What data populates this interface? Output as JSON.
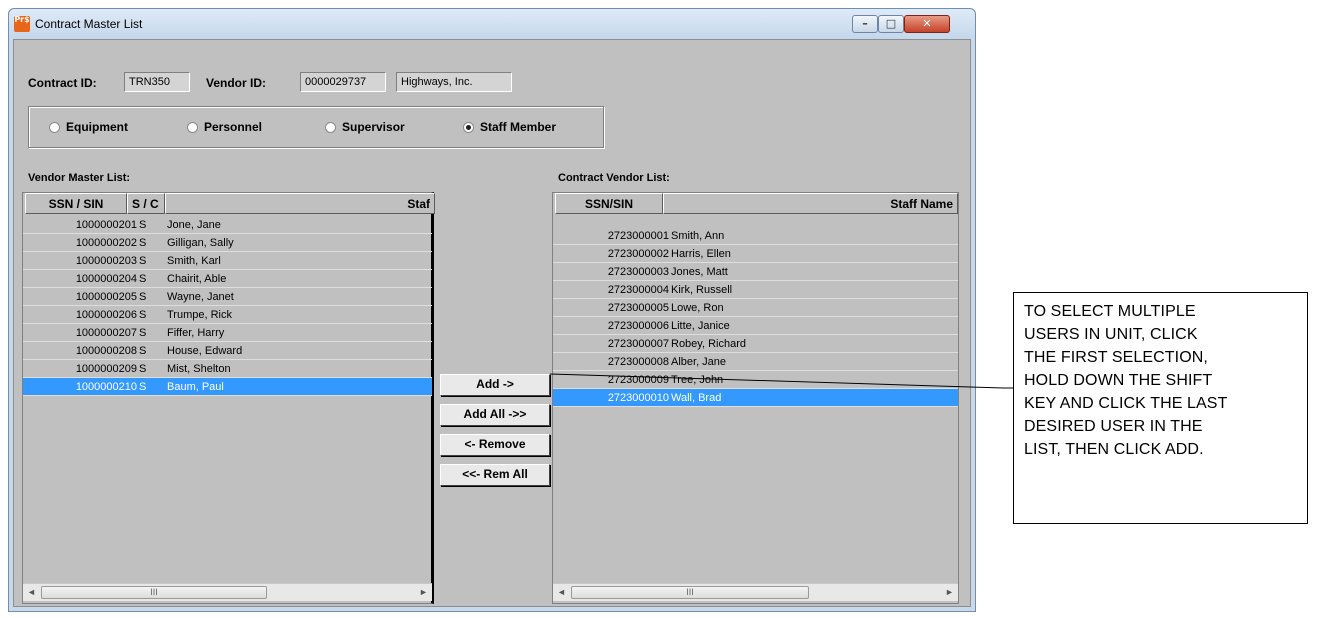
{
  "window": {
    "icon_text": "Pr$",
    "title": "Contract Master List",
    "min_glyph": "–",
    "max_glyph": "□",
    "close_glyph": "✕"
  },
  "contract": {
    "contract_id_label": "Contract ID:",
    "contract_id": "TRN350",
    "vendor_id_label": "Vendor ID:",
    "vendor_id": "0000029737",
    "vendor_name": "Highways, Inc."
  },
  "types": [
    {
      "label": "Equipment",
      "selected": false
    },
    {
      "label": "Personnel",
      "selected": false
    },
    {
      "label": "Supervisor",
      "selected": false
    },
    {
      "label": "Staff Member",
      "selected": true
    }
  ],
  "vendor_list": {
    "title": "Vendor Master List:",
    "headers": [
      "SSN / SIN",
      "S / C",
      "Staf"
    ],
    "rows": [
      {
        "ssn": "1000000201",
        "sc": "S",
        "name": "Jone, Jane"
      },
      {
        "ssn": "1000000202",
        "sc": "S",
        "name": "Gilligan, Sally"
      },
      {
        "ssn": "1000000203",
        "sc": "S",
        "name": "Smith, Karl"
      },
      {
        "ssn": "1000000204",
        "sc": "S",
        "name": "Chairit, Able"
      },
      {
        "ssn": "1000000205",
        "sc": "S",
        "name": "Wayne, Janet"
      },
      {
        "ssn": "1000000206",
        "sc": "S",
        "name": "Trumpe, Rick"
      },
      {
        "ssn": "1000000207",
        "sc": "S",
        "name": "Fiffer, Harry"
      },
      {
        "ssn": "1000000208",
        "sc": "S",
        "name": "House, Edward"
      },
      {
        "ssn": "1000000209",
        "sc": "S",
        "name": "Mist, Shelton"
      },
      {
        "ssn": "1000000210",
        "sc": "S",
        "name": "Baum, Paul",
        "selected": true
      }
    ]
  },
  "contract_list": {
    "title": "Contract Vendor List:",
    "headers": [
      "SSN/SIN",
      "Staff Name"
    ],
    "rows": [
      {
        "ssn": "2723000001",
        "name": "Smith, Ann"
      },
      {
        "ssn": "2723000002",
        "name": "Harris, Ellen"
      },
      {
        "ssn": "2723000003",
        "name": "Jones, Matt"
      },
      {
        "ssn": "2723000004",
        "name": "Kirk, Russell"
      },
      {
        "ssn": "2723000005",
        "name": "Lowe, Ron"
      },
      {
        "ssn": "2723000006",
        "name": "Litte, Janice"
      },
      {
        "ssn": "2723000007",
        "name": "Robey, Richard"
      },
      {
        "ssn": "2723000008",
        "name": "Alber, Jane"
      },
      {
        "ssn": "2723000009",
        "name": "Tree, John"
      },
      {
        "ssn": "2723000010",
        "name": "Wall, Brad",
        "selected": true
      }
    ]
  },
  "scroll": {
    "left_arrow": "◄",
    "right_arrow": "►",
    "grip": "III"
  },
  "buttons": {
    "add": "Add ->",
    "add_all": "Add All ->>",
    "remove": "<- Remove",
    "remove_all": "<<- Rem All"
  },
  "callout_lines": [
    "TO SELECT MULTIPLE",
    "USERS IN UNIT, CLICK",
    "THE FIRST SELECTION,",
    "HOLD DOWN THE SHIFT",
    "KEY AND CLICK THE LAST",
    "DESIRED USER IN THE",
    "LIST, THEN CLICK ADD."
  ],
  "colors": {
    "selection": "#3399ff",
    "window_frame": "#c9d9ea",
    "client": "#c0c0c0"
  }
}
